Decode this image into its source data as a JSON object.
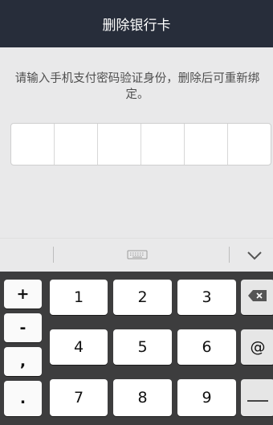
{
  "header": {
    "title": "删除银行卡"
  },
  "instruction": "请输入手机支付密码验证身份，删除后可重新绑定。",
  "pin": {
    "length": 6
  },
  "keyboard": {
    "left_keys": [
      "+",
      "-",
      ",",
      "."
    ],
    "digits": [
      "1",
      "2",
      "3",
      "4",
      "5",
      "6",
      "7",
      "8",
      "9"
    ],
    "right_keys": {
      "at": "@"
    },
    "icons": [
      "keyboard-icon",
      "chevron-down-icon",
      "backspace-icon",
      "space-dash-icon"
    ]
  }
}
